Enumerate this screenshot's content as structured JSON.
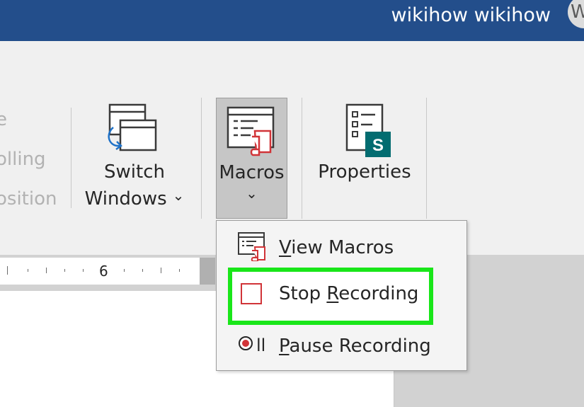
{
  "title_bar": {
    "username": "wikihow wikihow",
    "avatar_initial": "W"
  },
  "ribbon": {
    "partial_labels": [
      "e",
      "olling",
      "osition"
    ],
    "switch_windows": {
      "line1": "Switch",
      "line2": "Windows",
      "chevron": "⌄"
    },
    "macros": {
      "label": "Macros",
      "chevron": "⌄"
    },
    "properties": {
      "label": "Properties",
      "badge": "S"
    }
  },
  "ruler": {
    "number": "6"
  },
  "macros_menu": {
    "items": [
      {
        "first": "V",
        "rest": "iew Macros"
      },
      {
        "pre": "Stop ",
        "mn": "R",
        "post": "ecording"
      },
      {
        "first": "P",
        "rest": "ause Recording",
        "icon_text": "ll"
      }
    ]
  },
  "colors": {
    "title_bar": "#234e8b",
    "highlight": "#19e619",
    "record_red": "#d13438",
    "sharepoint_teal": "#036c70"
  }
}
